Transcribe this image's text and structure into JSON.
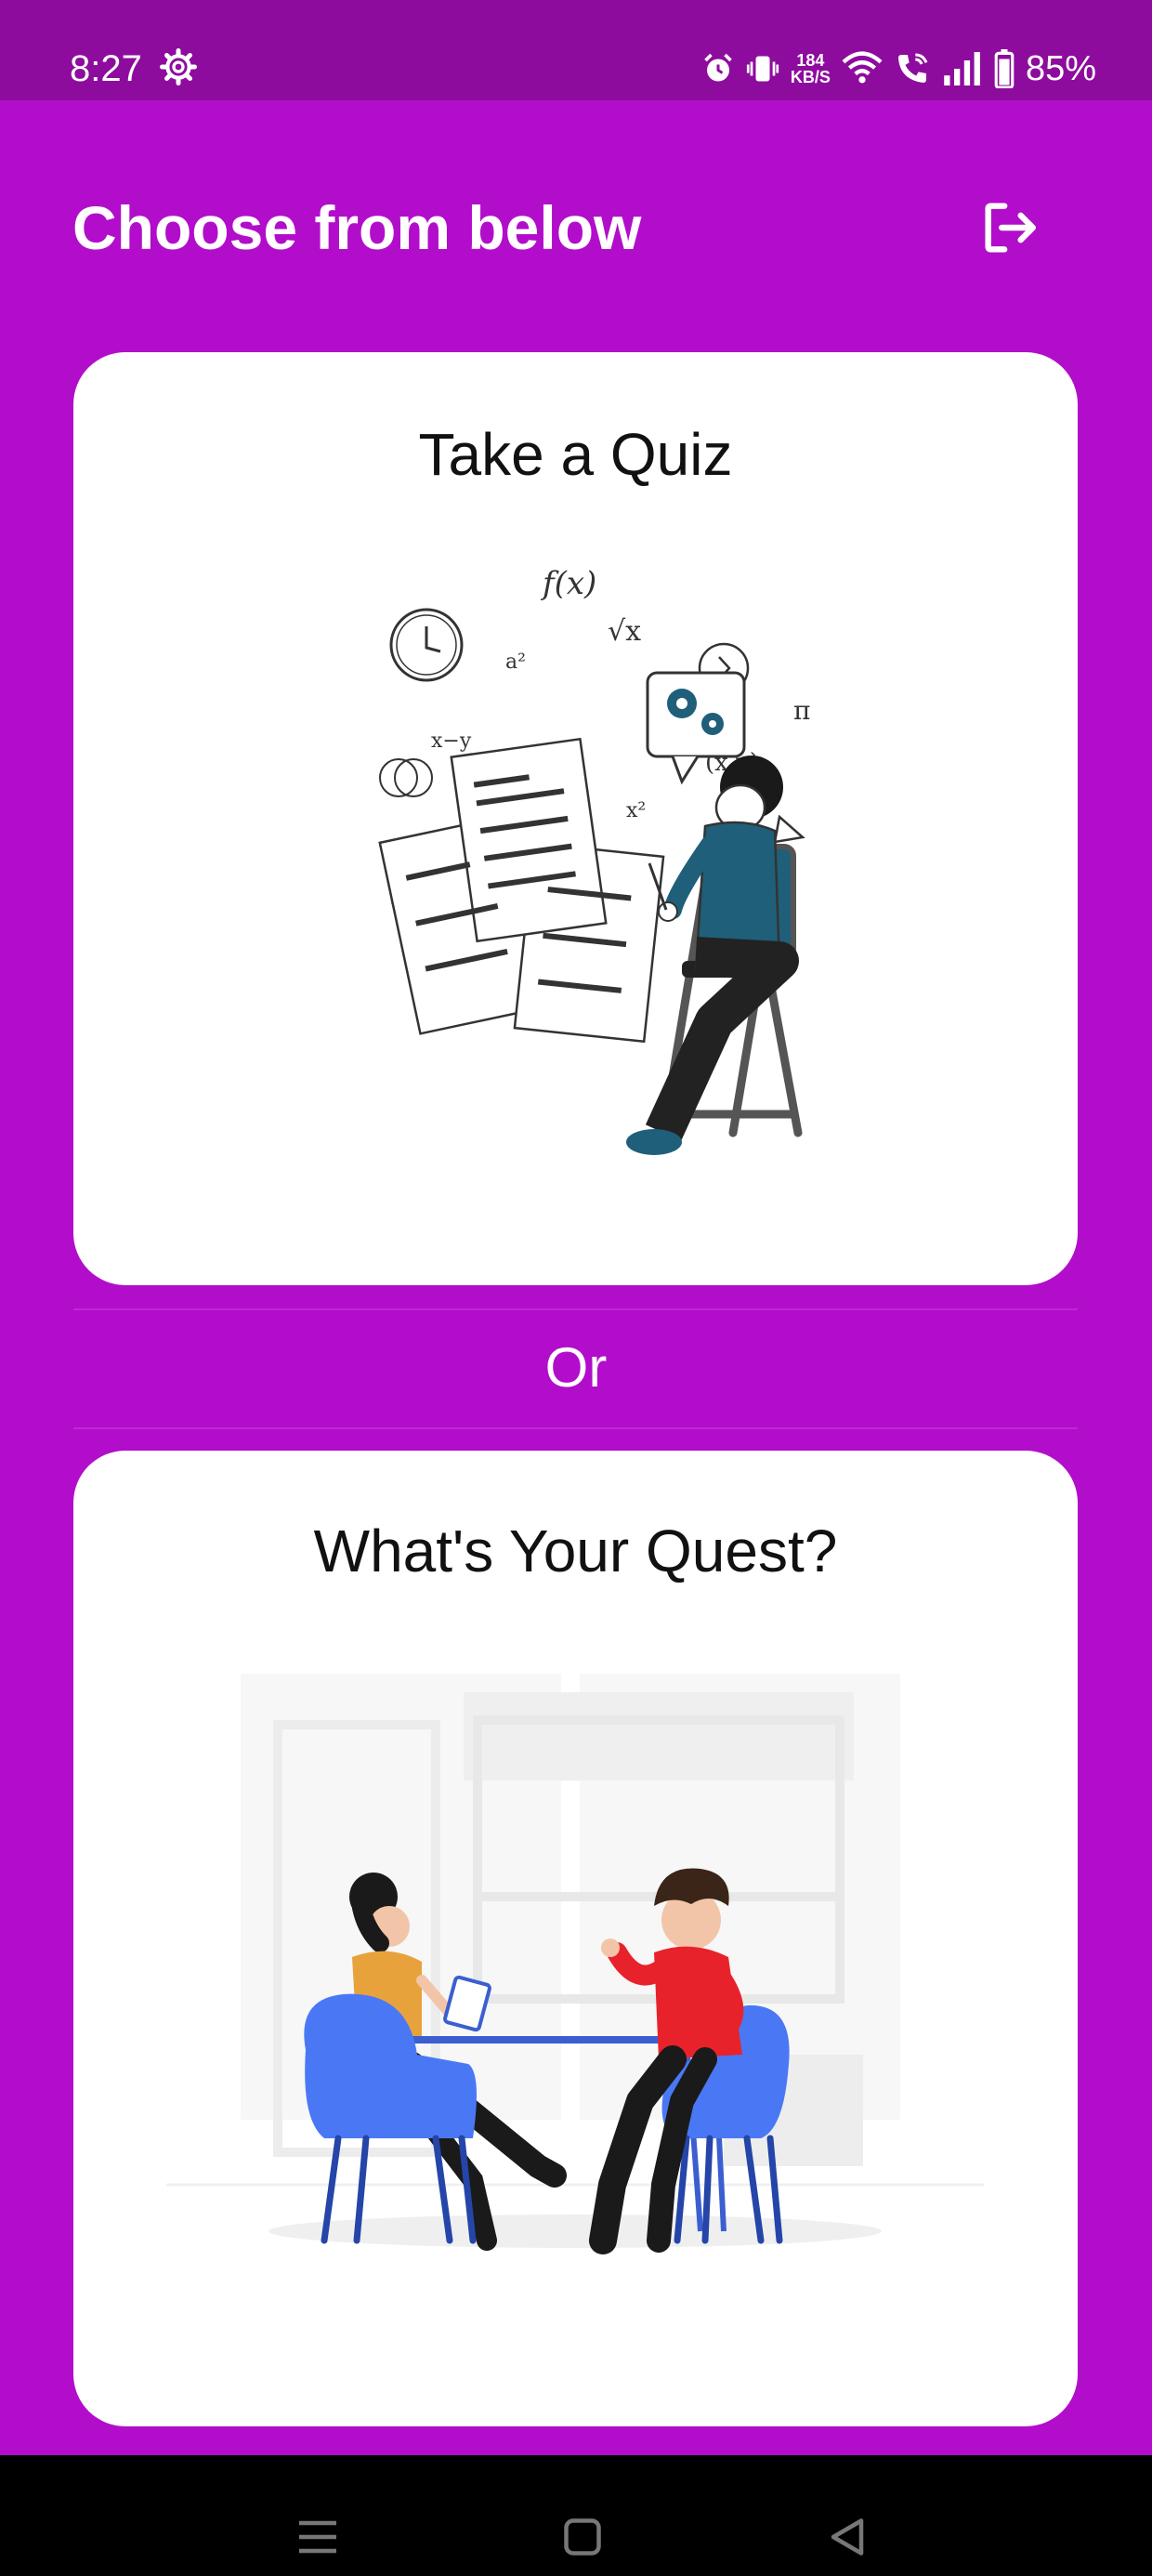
{
  "status_bar": {
    "time": "8:27",
    "network_speed_value": "184",
    "network_speed_unit": "KB/S",
    "battery_percent": "85%",
    "icons": [
      "settings-icon",
      "alarm-icon",
      "vibrate-icon",
      "wifi-icon",
      "wifi-calling-icon",
      "signal-icon",
      "battery-icon"
    ]
  },
  "header": {
    "title": "Choose from below",
    "logout_icon": "logout-icon"
  },
  "cards": [
    {
      "title": "Take a Quiz",
      "illustration": "quiz-illustration"
    },
    {
      "title": "What's Your Quest?",
      "illustration": "consultation-illustration"
    }
  ],
  "separator": {
    "label": "Or"
  },
  "nav_bar": {
    "icons": [
      "recents-icon",
      "home-icon",
      "back-icon"
    ]
  },
  "colors": {
    "background": "#B20DCB",
    "status_bar": "#8D0C9E",
    "card": "#FFFFFF",
    "accent_blue": "#4A78F5",
    "accent_teal": "#1F5F7A",
    "accent_red": "#E8222B"
  }
}
